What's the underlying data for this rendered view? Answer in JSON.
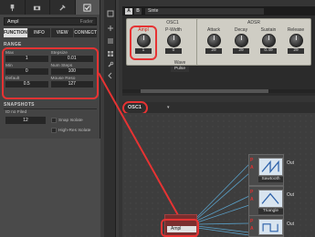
{
  "left_panel": {
    "tabs": [
      "plug-icon",
      "camera-icon",
      "gear-icon",
      "checkbox-icon"
    ],
    "module_name": "Ampl",
    "module_type": "Fader",
    "subtabs": [
      "FUNCTION",
      "INFO",
      "VIEW",
      "CONNECT"
    ],
    "range_title": "RANGE",
    "params": [
      {
        "label": "Max",
        "value": "1"
      },
      {
        "label": "Stepsize",
        "value": "0.01"
      },
      {
        "label": "Min",
        "value": "0"
      },
      {
        "label": "Num Steps",
        "value": "100"
      },
      {
        "label": "Default",
        "value": "0.5"
      },
      {
        "label": "Mouse Reso",
        "value": "127"
      }
    ],
    "snapshots_title": "SNAPSHOTS",
    "snapshot_label": "ID no Filed",
    "snapshot_value": "12",
    "snap_isolate": "Snap Isolate",
    "high_res": "High-Res Isolate"
  },
  "synth": {
    "slot_a": "A",
    "slot_b": "B",
    "name": "Sinte",
    "osc_title": "OSC1",
    "adsr_title": "ADSR",
    "ampl_label": "Ampl",
    "ampl_value": "1",
    "pwidth_label": "P-Width",
    "pwidth_value": "0",
    "wave_label": "Wave",
    "wave_value": "Pulse",
    "attack_label": "Attack",
    "attack_value": "29",
    "decay_label": "Decay",
    "decay_value": "29",
    "sustain_label": "Sustain",
    "sustain_value": "0.49",
    "release_label": "Release",
    "release_value": "29"
  },
  "structure": {
    "osc_label": "OSC1",
    "modules": [
      {
        "p": "P",
        "a": "A",
        "out": "Out",
        "wave": "Sawtooth"
      },
      {
        "p": "P",
        "a": "A",
        "out": "Out",
        "wave": "Triangle"
      },
      {
        "p": "P",
        "a": "A",
        "out": "Out",
        "wave": ""
      }
    ],
    "instance_label": "Ampl"
  },
  "colors": {
    "highlight": "#e63333",
    "panel": "#cfcdc4",
    "scope": "#d8e4ef",
    "wave": "#2a5fa8"
  }
}
